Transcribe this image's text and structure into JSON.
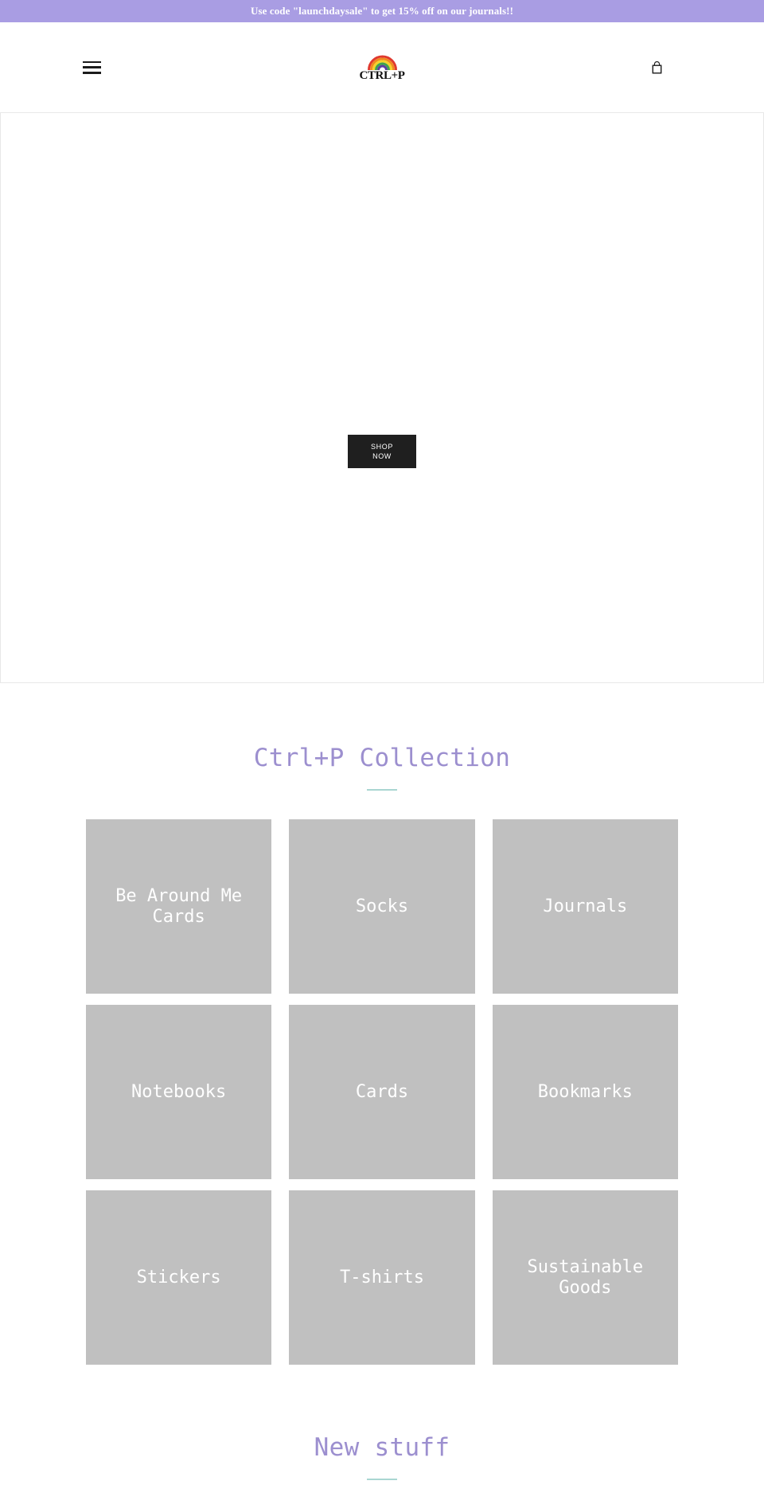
{
  "announcement": {
    "text": "Use code \"launchdaysale\" to get 15% off on our journals!!",
    "background_color": "#a99de3",
    "text_color": "#ffffff"
  },
  "header": {
    "menu_label": "Menu",
    "logo": {
      "wordmark": "CTRL+P",
      "icon_name": "rainbow-logo",
      "rainbow_colors": [
        "#e03a2f",
        "#f08a1e",
        "#f5d32a",
        "#3fa34d",
        "#5b3fa0"
      ]
    },
    "cart": {
      "icon_name": "shopping-bag-icon",
      "label": "Cart"
    }
  },
  "hero": {
    "cta_line_1": "SHOP",
    "cta_line_2": "NOW",
    "cta_background": "#1f1f1f",
    "cta_text_color": "#ffffff"
  },
  "collection_section": {
    "heading": "Ctrl+P Collection",
    "heading_color": "#9c8fcf",
    "rule_color": "#a9d6d2",
    "tiles": [
      {
        "title": "Be Around Me Cards"
      },
      {
        "title": "Socks"
      },
      {
        "title": "Journals"
      },
      {
        "title": "Notebooks"
      },
      {
        "title": "Cards"
      },
      {
        "title": "Bookmarks"
      },
      {
        "title": "Stickers"
      },
      {
        "title": "T-shirts"
      },
      {
        "title": "Sustainable Goods"
      }
    ],
    "tile_background": "#c0c0c0",
    "tile_text_color": "#ffffff"
  },
  "new_stuff_section": {
    "heading": "New stuff",
    "heading_color": "#9c8fcf",
    "rule_color": "#a9d6d2"
  }
}
